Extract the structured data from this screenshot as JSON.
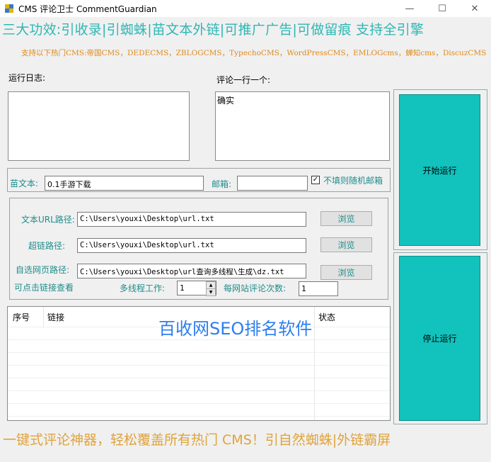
{
  "window": {
    "title": "CMS 评论卫士 CommentGuardian",
    "minimize_glyph": "—",
    "maximize_glyph": "☐",
    "close_glyph": "✕"
  },
  "banner": "三大功效:引收录|引蜘蛛|苗文本外链|可推广广告|可做留痕 支持全引擎",
  "cms_support": "支持以下热门CMS:帝国CMS，DEDECMS，ZBLOGCMS，TypechoCMS，WordPressCMS，EMLOGcms，蝉知cms，DiscuzCMS",
  "log": {
    "label": "运行日志:",
    "value": ""
  },
  "comments": {
    "label": "评论一行一个:",
    "value": "确实"
  },
  "anchor": {
    "label": "苗文本:",
    "value": "0.1手游下载"
  },
  "email": {
    "label": "邮箱:",
    "value": ""
  },
  "random_email": {
    "label": "不填则随机邮箱",
    "checked": true,
    "check_glyph": "✓"
  },
  "paths": {
    "text_url": {
      "label": "文本URL路径:",
      "value": "C:\\Users\\youxi\\Desktop\\url.txt",
      "button": "浏览"
    },
    "link": {
      "label": "超链路径:",
      "value": "C:\\Users\\youxi\\Desktop\\url.txt",
      "button": "浏览"
    },
    "custom_page": {
      "label": "自选网页路径:",
      "value": "C:\\Users\\youxi\\Desktop\\url查询多线程\\生成\\dz.txt",
      "button": "浏览"
    }
  },
  "hint": "可点击链接查看",
  "threads": {
    "label": "多线程工作:",
    "value": "1",
    "up_glyph": "▲",
    "down_glyph": "▼"
  },
  "per_site": {
    "label": "每网站评论次数:",
    "value": "1"
  },
  "table": {
    "columns": [
      "序号",
      "链接",
      "状态"
    ],
    "rows": []
  },
  "watermark": "百收网SEO排名软件",
  "start_button": "开始运行",
  "stop_button": "停止运行",
  "footer_slogan": "一键式评论神器，轻松覆盖所有热门 CMS！引自然蜘蛛|外链霸屏",
  "colors": {
    "accent": "#12c2bd",
    "banner": "#2fb7b5",
    "orange": "#e08a1a",
    "watermark": "#2d7ef0"
  },
  "icons": {
    "app": "app-icon"
  }
}
